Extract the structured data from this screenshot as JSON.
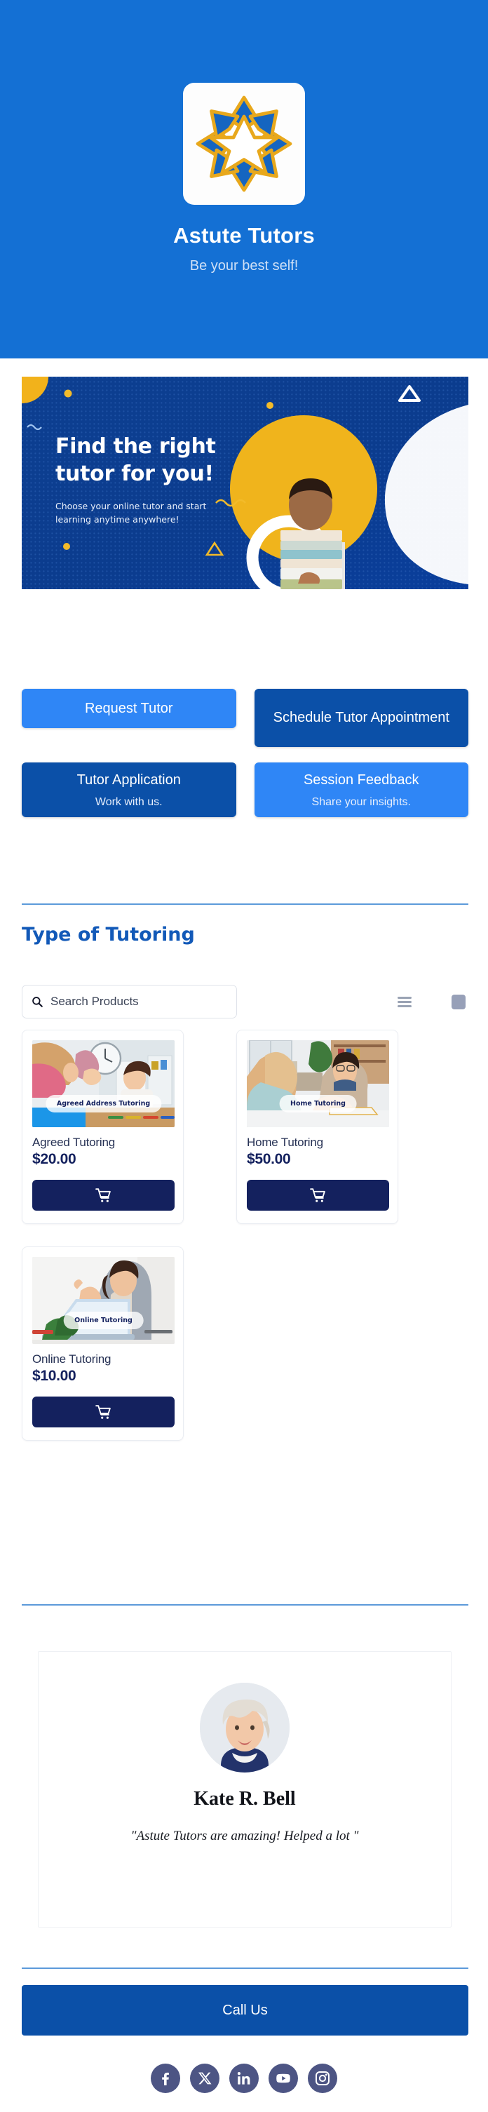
{
  "header": {
    "logo_icon": "eight-point-star-logo",
    "title": "Astute Tutors",
    "tagline": "Be your best self!",
    "bg_color": "#1470d4"
  },
  "hero": {
    "title_line1": "Find the right",
    "title_line2": "tutor for you!",
    "subtitle_line1": "Choose your online tutor and start",
    "subtitle_line2": "learning anytime anywhere!",
    "bg_color": "#0b3b8c",
    "accent_color": "#f2b21b"
  },
  "actions": [
    {
      "label": "Request Tutor",
      "sub": "",
      "style": "light"
    },
    {
      "label": "Schedule Tutor Appointment",
      "sub": "",
      "style": "dark"
    },
    {
      "label": "Tutor Application",
      "sub": "Work with us.",
      "style": "dark"
    },
    {
      "label": "Session Feedback",
      "sub": "Share your insights.",
      "style": "light"
    }
  ],
  "tutoring_section": {
    "heading": "Type of Tutoring",
    "search": {
      "placeholder": "Search Products",
      "value": "",
      "icon": "search-icon"
    },
    "view_toggles": [
      {
        "name": "list-view-icon",
        "active": false
      },
      {
        "name": "grid-view-icon",
        "active": true
      },
      {
        "name": "single-view-icon",
        "active": false
      }
    ],
    "products": [
      {
        "name": "Agreed Tutoring",
        "price": "$20.00",
        "image_badge": "Agreed Address Tutoring",
        "cart_icon": "shopping-cart-icon"
      },
      {
        "name": "Home Tutoring",
        "price": "$50.00",
        "image_badge": "Home Tutoring",
        "cart_icon": "shopping-cart-icon"
      },
      {
        "name": "Online Tutoring",
        "price": "$10.00",
        "image_badge": "Online Tutoring",
        "cart_icon": "shopping-cart-icon"
      }
    ]
  },
  "testimonial": {
    "avatar": "user-avatar",
    "name": "Kate R. Bell",
    "quote": "\"Astute Tutors are amazing! Helped a lot \""
  },
  "footer": {
    "call_label": "Call Us",
    "socials": [
      {
        "name": "facebook-icon"
      },
      {
        "name": "x-twitter-icon"
      },
      {
        "name": "linkedin-icon"
      },
      {
        "name": "youtube-icon"
      },
      {
        "name": "instagram-icon"
      }
    ],
    "social_color": "#4d5584"
  },
  "colors": {
    "header_blue": "#1470d4",
    "btn_light": "#2f86f6",
    "btn_dark": "#0b50a8",
    "navy": "#14215e",
    "divider": "#5c9ada",
    "heading": "#1259b8"
  }
}
